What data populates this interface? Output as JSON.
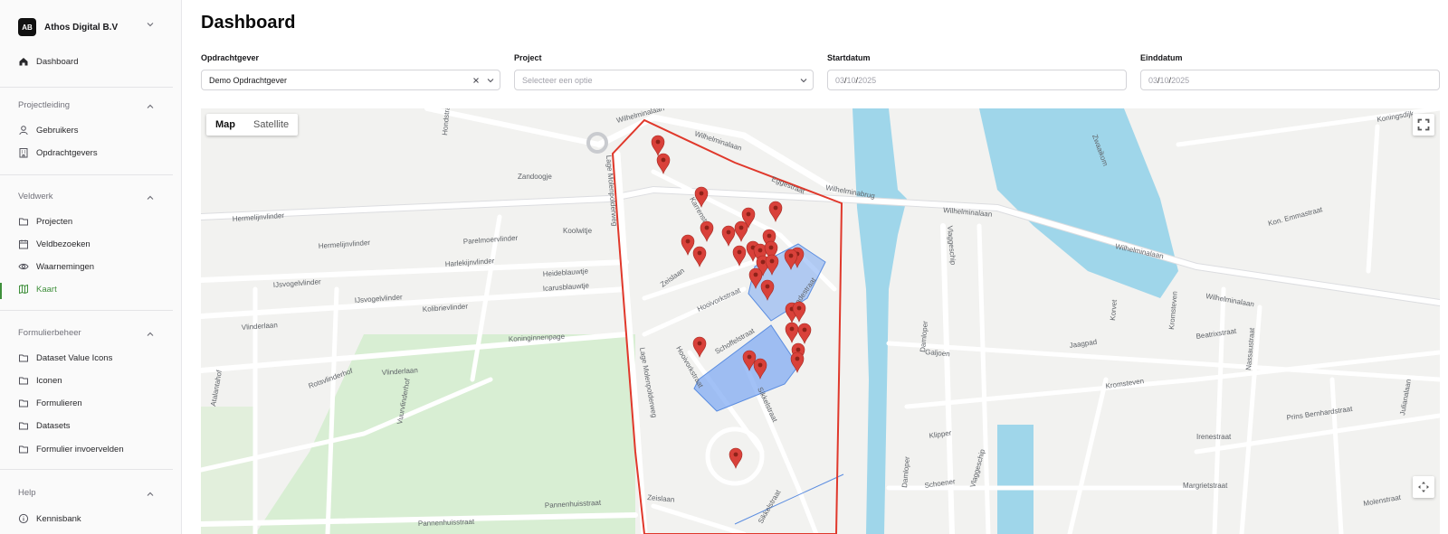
{
  "sidebar": {
    "org": {
      "initials": "AB",
      "name": "Athos Digital B.V"
    },
    "top_item": "Dashboard",
    "sections": [
      {
        "title": "Projectleiding",
        "items": [
          "Gebruikers",
          "Opdrachtgevers"
        ]
      },
      {
        "title": "Veldwerk",
        "items": [
          "Projecten",
          "Veldbezoeken",
          "Waarnemingen",
          "Kaart"
        ]
      },
      {
        "title": "Formulierbeheer",
        "items": [
          "Dataset Value Icons",
          "Iconen",
          "Formulieren",
          "Datasets",
          "Formulier invoervelden"
        ]
      },
      {
        "title": "Help",
        "items": [
          "Kennisbank"
        ]
      }
    ],
    "active_item": "Kaart"
  },
  "page": {
    "title": "Dashboard"
  },
  "filters": {
    "client": {
      "label": "Opdrachtgever",
      "value": "Demo Opdrachtgever"
    },
    "project": {
      "label": "Project",
      "placeholder": "Selecteer een optie"
    },
    "start": {
      "label": "Startdatum",
      "day": "03",
      "month": "10",
      "year": "2025"
    },
    "end": {
      "label": "Einddatum",
      "day": "03",
      "month": "10",
      "year": "2025"
    }
  },
  "map": {
    "tabs": {
      "map": "Map",
      "satellite": "Satellite"
    },
    "street_labels": {
      "wilhelminalaan": "Wilhelminalaan",
      "wilhelminabrug": "Wilhelminabrug",
      "zandoogje": "Zandoogje",
      "parelmoervlinder": "Parelmoervlinder",
      "koolwitje": "Koolwitje",
      "hermelijnvlinder": "Hermelijnvlinder",
      "harlekijnvlinder": "Harlekijnvlinder",
      "heideblauwtje": "Heideblauwtje",
      "icarusblauwtje": "Icarusblauwtje",
      "ijsvogelvlinder": "IJsvogelvlinder",
      "kolibrievlinder": "Kolibrievlinder",
      "koninginnenpage": "Koninginnenpage",
      "vlinderlaan": "Vlinderlaan",
      "atalantahof": "Atalantahof",
      "rotsvlinderhof": "Rotsvlinderhof",
      "vuurvlinderhof": "Vuurvlinderhof",
      "pannenhuisstraat": "Pannenhuisstraat",
      "lage_molenpolderweg": "Lage Molenpolderweg",
      "zeislaan": "Zeislaan",
      "hooivorkstraat": "Hooivorkstraat",
      "schoffelstraat": "Schoffelstraat",
      "sikkelstraat": "Sikkelstraat",
      "eggestraat": "Eggestraat",
      "karrenstraat": "Karrenstraat",
      "spadestraat": "Spadestraat",
      "damloper": "Damloper",
      "vlaggeschip": "Vlaggeschip",
      "jaagpad": "Jaagpad",
      "korvet": "Korvet",
      "klipper": "Klipper",
      "schoener": "Schoener",
      "kromsteven": "Kromsteven",
      "beatrixstraat": "Beatrixstraat",
      "nassaustraat": "Nassaustraat",
      "irenestraat": "Irenestraat",
      "margrietstraat": "Margrietstraat",
      "prins_bernhardstraat": "Prins Bernhardstraat",
      "molenstraat": "Molenstraat",
      "julianalaan": "Julianalaan",
      "emmastraat": "Kon. Emmastraat",
      "koningsdijk": "Koningsdijk",
      "zwaaikom": "Zwaaikom",
      "hondstraat": "Hondstraat",
      "stationsweg": "Galjoen"
    },
    "colors": {
      "boundary": "#e0382b",
      "polygon_fill": "#7aa7f2",
      "marker": "#d9413a",
      "water": "#9fd6ea",
      "park": "#d6ecd2"
    }
  }
}
